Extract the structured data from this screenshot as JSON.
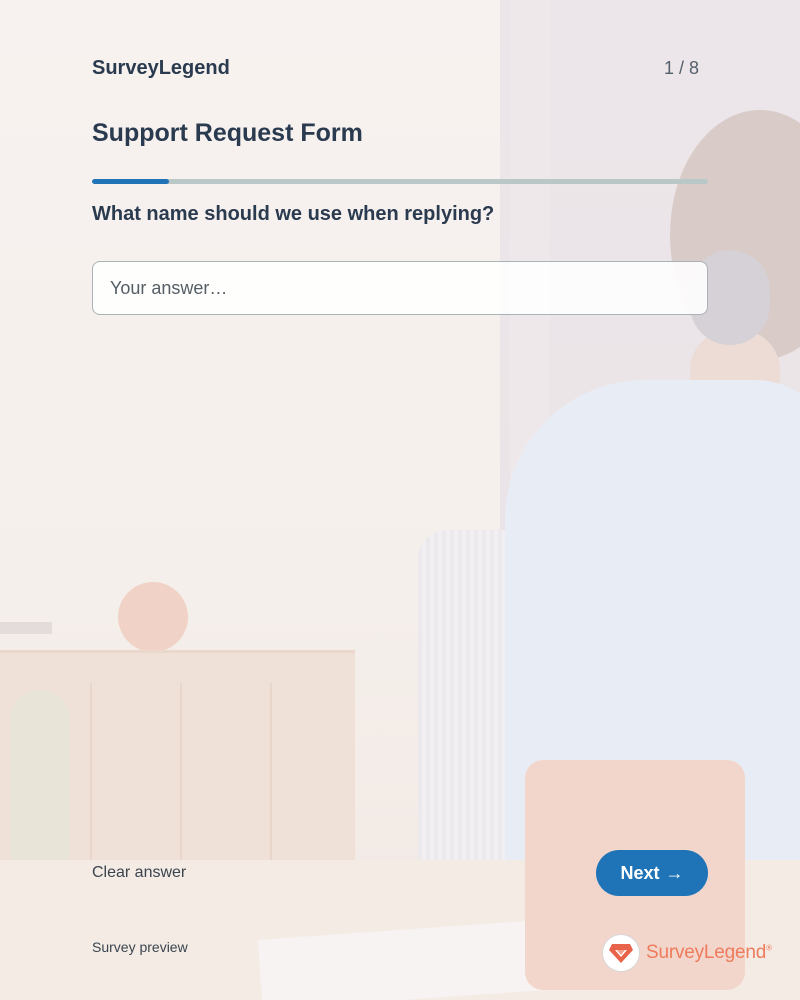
{
  "header": {
    "brand": "SurveyLegend",
    "page_counter": "1 / 8"
  },
  "form": {
    "title": "Support Request Form",
    "progress": 0.125,
    "question": "What name should we use when replying?",
    "answer_placeholder": "Your answer…",
    "answer_value": ""
  },
  "actions": {
    "clear_label": "Clear answer",
    "next_label": "Next",
    "next_arrow": "→"
  },
  "footer": {
    "note": "Survey preview",
    "logo_text": "SurveyLegend",
    "logo_mark": "®"
  },
  "colors": {
    "accent": "#1f73b7",
    "brand_logo": "#ee7b5c",
    "heading": "#2a3a4f"
  },
  "icons": {
    "next": "arrow-right-icon",
    "logo": "surveylegend-diamond-icon"
  }
}
